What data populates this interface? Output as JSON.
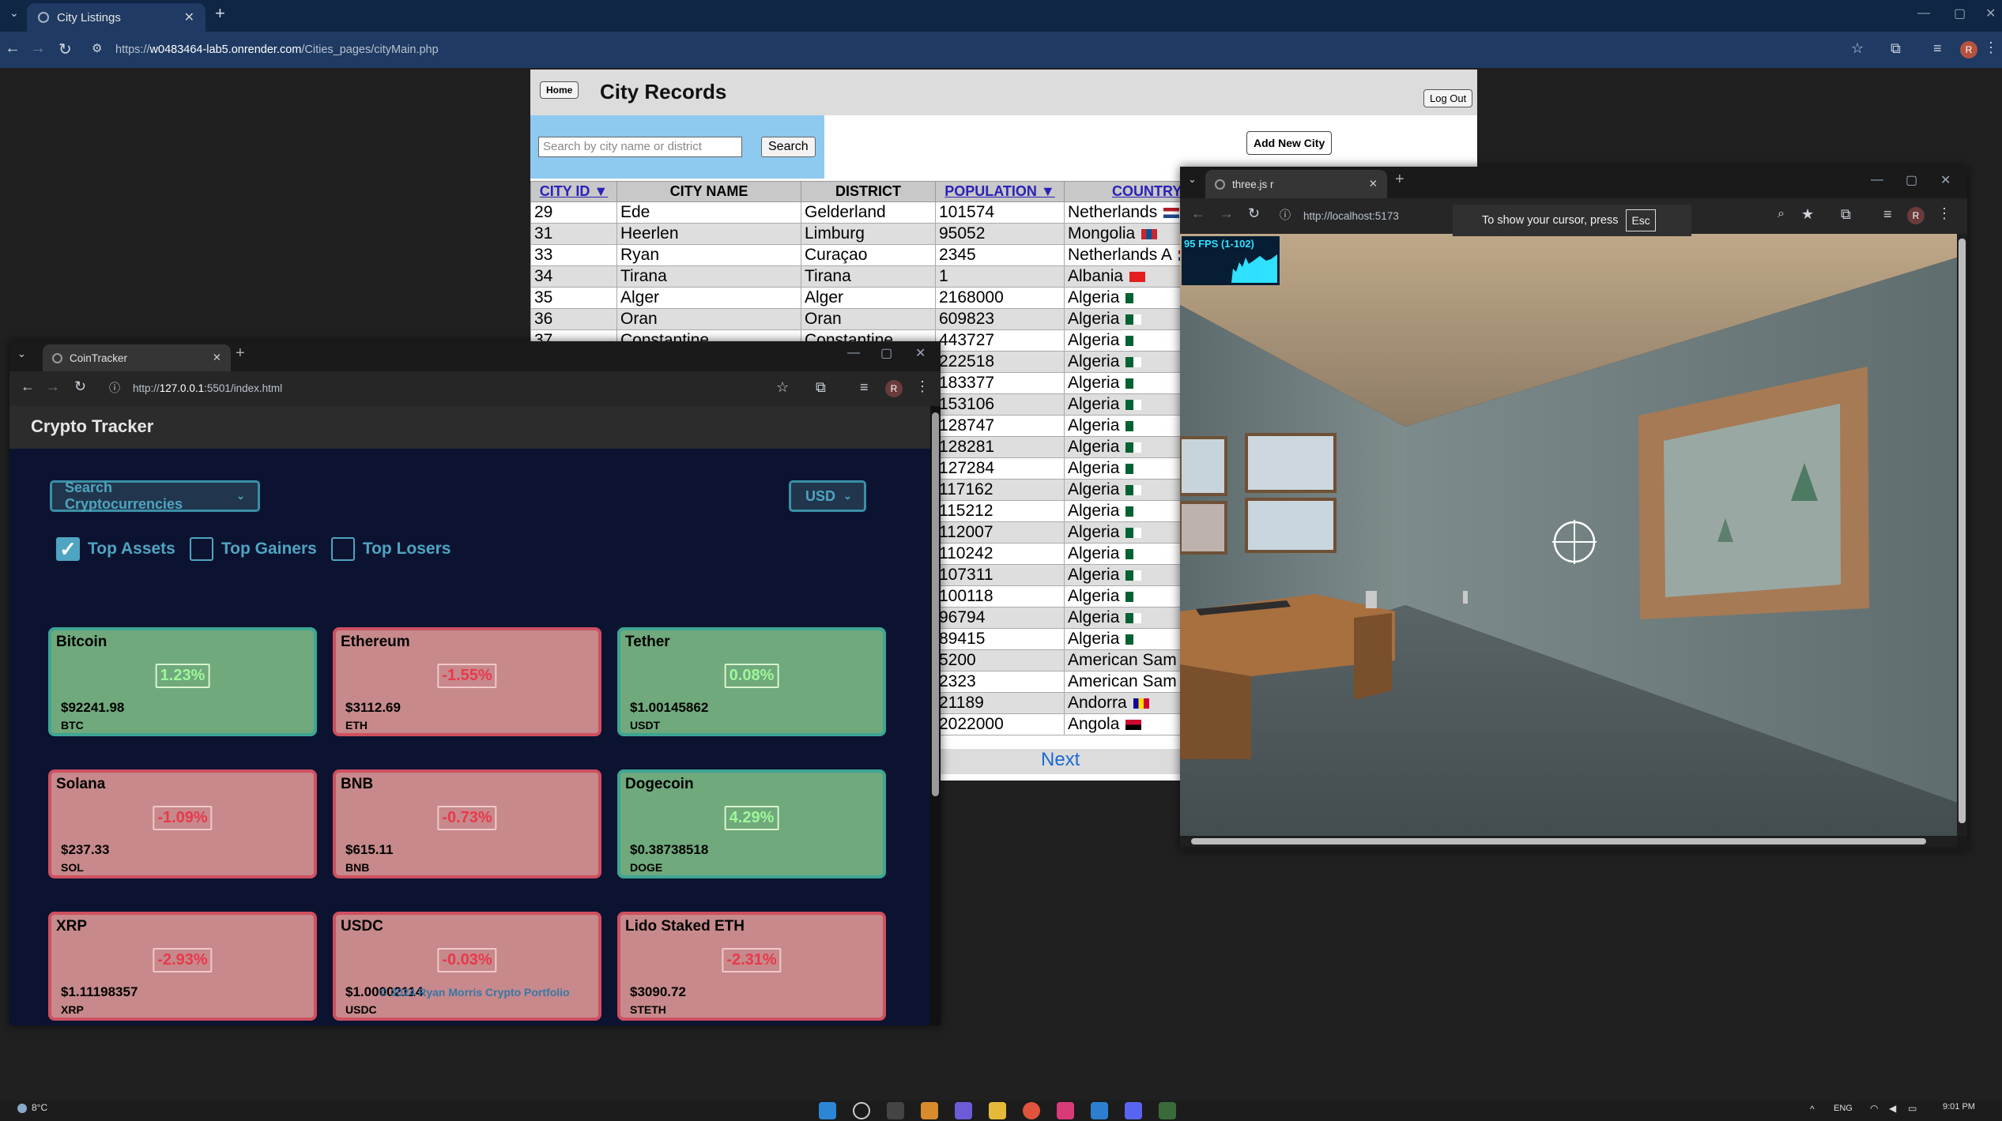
{
  "city_window": {
    "tab_title": "City Listings",
    "url_prefix": "https://",
    "url_host": "w0483464-lab5.onrender.com",
    "url_path": "/Cities_pages/cityMain.php",
    "home_label": "Home",
    "page_title": "City Records",
    "logout_label": "Log Out",
    "search_placeholder": "Search by city name or district",
    "search_label": "Search",
    "add_label": "Add New City",
    "columns": [
      "CITY ID ▼",
      "CITY NAME",
      "DISTRICT",
      "POPULATION ▼",
      "COUNTRY"
    ],
    "rows": [
      [
        "29",
        "Ede",
        "Gelderland",
        "101574",
        "Netherlands"
      ],
      [
        "31",
        "Heerlen",
        "Limburg",
        "95052",
        "Mongolia"
      ],
      [
        "33",
        "Ryan",
        "Curaçao",
        "2345",
        "Netherlands A"
      ],
      [
        "34",
        "Tirana",
        "Tirana",
        "1",
        "Albania"
      ],
      [
        "35",
        "Alger",
        "Alger",
        "2168000",
        "Algeria"
      ],
      [
        "36",
        "Oran",
        "Oran",
        "609823",
        "Algeria"
      ],
      [
        "37",
        "Constantine",
        "Constantine",
        "443727",
        "Algeria"
      ],
      [
        "",
        "",
        "",
        "222518",
        "Algeria"
      ],
      [
        "",
        "",
        "",
        "183377",
        "Algeria"
      ],
      [
        "",
        "",
        "",
        "153106",
        "Algeria"
      ],
      [
        "",
        "",
        "",
        "128747",
        "Algeria"
      ],
      [
        "",
        "",
        "",
        "128281",
        "Algeria"
      ],
      [
        "",
        "",
        "",
        "127284",
        "Algeria"
      ],
      [
        "",
        "",
        "",
        "117162",
        "Algeria"
      ],
      [
        "",
        "",
        "",
        "115212",
        "Algeria"
      ],
      [
        "",
        "",
        "",
        "112007",
        "Algeria"
      ],
      [
        "",
        "",
        "",
        "110242",
        "Algeria"
      ],
      [
        "",
        "",
        "",
        "107311",
        "Algeria"
      ],
      [
        "",
        "",
        "",
        "100118",
        "Algeria"
      ],
      [
        "",
        "",
        "",
        "96794",
        "Algeria"
      ],
      [
        "",
        "",
        "",
        "89415",
        "Algeria"
      ],
      [
        "",
        "",
        "",
        "5200",
        "American Sam"
      ],
      [
        "",
        "",
        "",
        "2323",
        "American Sam"
      ],
      [
        "",
        "",
        "",
        "21189",
        "Andorra"
      ],
      [
        "",
        "",
        "",
        "2022000",
        "Angola"
      ]
    ],
    "next_label": "Next"
  },
  "coin_window": {
    "tab_title": "CoinTracker",
    "url_prefix": "http://",
    "url_host": "127.0.0.1",
    "url_path": ":5501/index.html",
    "header": "Crypto Tracker",
    "search_dropdown": "Search Cryptocurrencies",
    "currency": "USD",
    "filters": [
      {
        "label": "Top Assets",
        "checked": true
      },
      {
        "label": "Top Gainers",
        "checked": false
      },
      {
        "label": "Top Losers",
        "checked": false
      }
    ],
    "cards": [
      {
        "name": "Bitcoin",
        "pct": "1.23%",
        "price": "$92241.98",
        "symbol": "BTC",
        "trend": "up"
      },
      {
        "name": "Ethereum",
        "pct": "-1.55%",
        "price": "$3112.69",
        "symbol": "ETH",
        "trend": "down"
      },
      {
        "name": "Tether",
        "pct": "0.08%",
        "price": "$1.00145862",
        "symbol": "USDT",
        "trend": "up"
      },
      {
        "name": "Solana",
        "pct": "-1.09%",
        "price": "$237.33",
        "symbol": "SOL",
        "trend": "down"
      },
      {
        "name": "BNB",
        "pct": "-0.73%",
        "price": "$615.11",
        "symbol": "BNB",
        "trend": "down"
      },
      {
        "name": "Dogecoin",
        "pct": "4.29%",
        "price": "$0.38738518",
        "symbol": "DOGE",
        "trend": "up"
      },
      {
        "name": "XRP",
        "pct": "-2.93%",
        "price": "$1.11198357",
        "symbol": "XRP",
        "trend": "down"
      },
      {
        "name": "USDC",
        "pct": "-0.03%",
        "price": "$1.00002114",
        "symbol": "USDC",
        "trend": "down"
      },
      {
        "name": "Lido Staked ETH",
        "pct": "-2.31%",
        "price": "$3090.72",
        "symbol": "STETH",
        "trend": "down"
      }
    ],
    "footer": "© 2024 Ryan Morris Crypto Portfolio"
  },
  "three_window": {
    "tab_title": "three.js r",
    "url": "http://localhost:5173",
    "fps": "95 FPS (1-102)",
    "cursor_tip": "To show your cursor, press",
    "esc_key": "Esc"
  },
  "taskbar": {
    "weather": "8°C",
    "lang": "ENG",
    "time": "9:01 PM"
  },
  "colors": {
    "gain": "#6fa97c",
    "loss": "#c7898b",
    "accent": "#4ea4c1"
  }
}
